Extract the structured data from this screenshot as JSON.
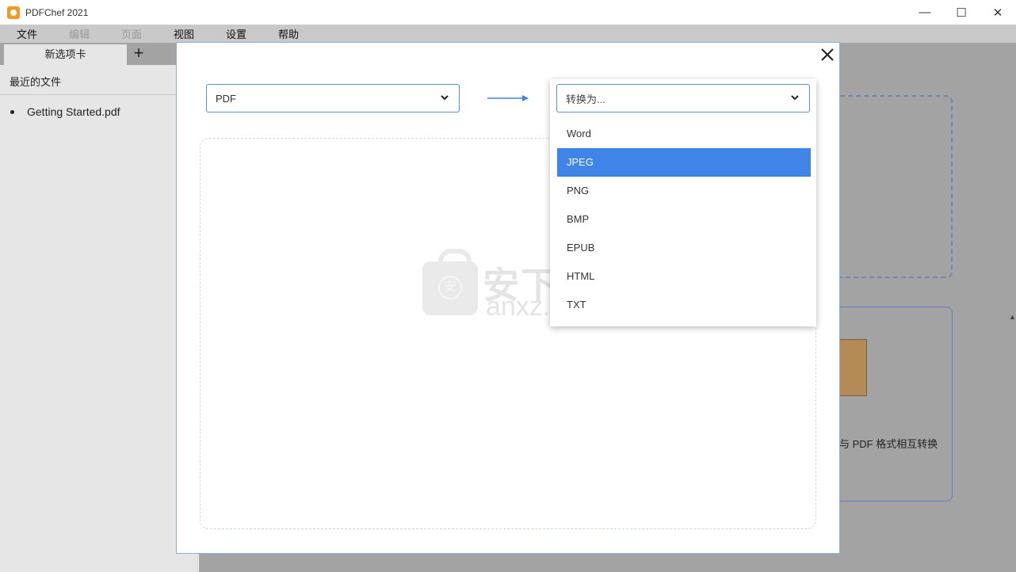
{
  "window": {
    "title": "PDFChef 2021",
    "controls": {
      "minimize": "—",
      "maximize": "☐",
      "close": "✕"
    }
  },
  "menu": [
    {
      "label": "文件",
      "enabled": true
    },
    {
      "label": "编辑",
      "enabled": false
    },
    {
      "label": "页面",
      "enabled": false
    },
    {
      "label": "视图",
      "enabled": true
    },
    {
      "label": "设置",
      "enabled": true
    },
    {
      "label": "帮助",
      "enabled": true
    }
  ],
  "tabs": {
    "active_label": "新选项卡",
    "add_label": "+"
  },
  "sidebar": {
    "title": "最近的文件",
    "recent_files": [
      "Getting Started.pdf"
    ]
  },
  "background_card": {
    "text": "与 PDF 格式相互转换"
  },
  "dialog": {
    "close_label": "✕",
    "from_format": "PDF",
    "to_placeholder": "转换为...",
    "options": [
      "Word",
      "JPEG",
      "PNG",
      "BMP",
      "EPUB",
      "HTML",
      "TXT"
    ],
    "highlighted_option": "JPEG"
  },
  "watermark": {
    "cn": "安下载",
    "en": "anxz.com",
    "lock_glyph": "安"
  },
  "colors": {
    "accent": "#3f85e7",
    "border": "#5b8fe0",
    "menubar": "#c9c9c9",
    "overlay": "#a3a3a3",
    "app_icon": "#f39a23"
  }
}
